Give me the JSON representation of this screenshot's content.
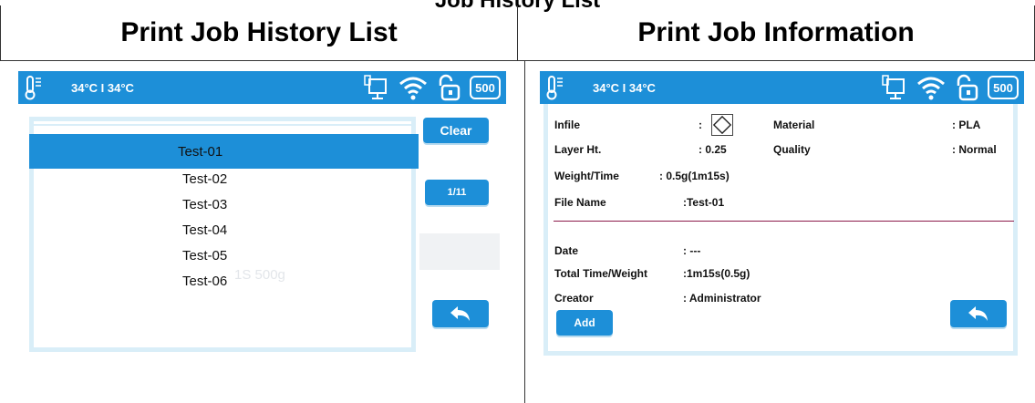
{
  "caption_top": "Job History List",
  "headers": {
    "left": "Print Job History List",
    "right": "Print Job Information"
  },
  "status_bar": {
    "temperature": "34°C I 34°C",
    "filament_badge": "500",
    "icons": [
      "thermometer-icon",
      "printer-connection-icon",
      "wifi-icon",
      "unlock-icon",
      "filament-badge"
    ]
  },
  "history": {
    "clear_label": "Clear",
    "page_label": "1/11",
    "items": [
      "Test-01",
      "Test-02",
      "Test-03",
      "Test-04",
      "Test-05",
      "Test-06"
    ],
    "selected_index": 0,
    "ghost_text": "1S      500g"
  },
  "info": {
    "rows": [
      {
        "label": "Infile",
        "value": ":"
      },
      {
        "label": "Material",
        "value": ": PLA"
      },
      {
        "label": "Layer Ht.",
        "value": ": 0.25"
      },
      {
        "label": "Quality",
        "value": ": Normal"
      },
      {
        "label": "Weight/Time",
        "value": ": 0.5g(1m15s)"
      },
      {
        "label": "File Name",
        "value": ":Test-01"
      },
      {
        "label": "Date",
        "value": ": ---"
      },
      {
        "label": "Total Time/Weight",
        "value": ":1m15s(0.5g)"
      },
      {
        "label": "Creator",
        "value": ": Administrator"
      }
    ],
    "add_label": "Add"
  },
  "colors": {
    "accent": "#1d8fd8",
    "frame": "#d9eef8",
    "rule": "#8b1a4a"
  }
}
